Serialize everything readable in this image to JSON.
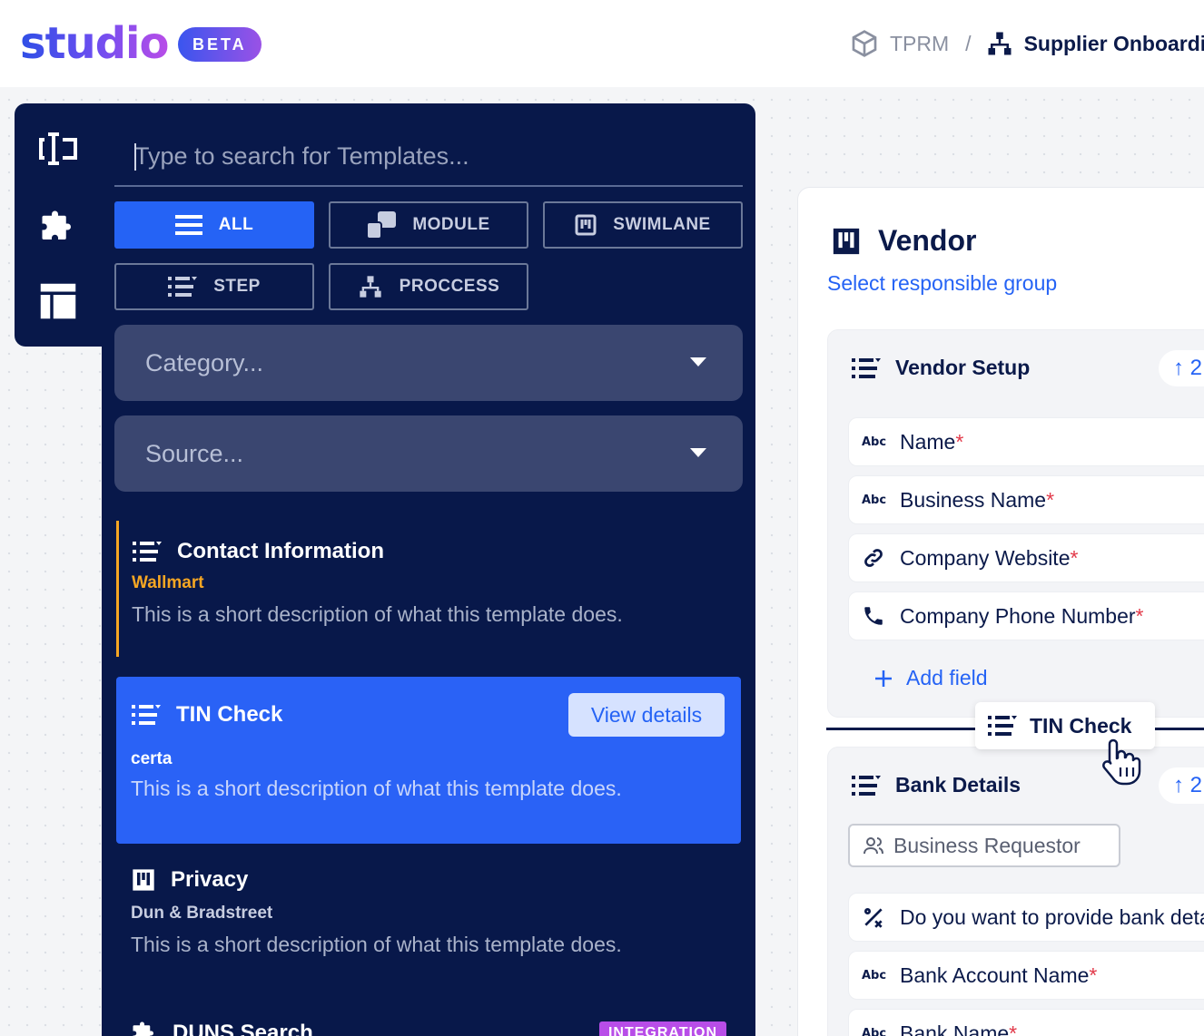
{
  "header": {
    "logo_text": "studio",
    "beta_label": "BETA",
    "breadcrumb": {
      "first": "TPRM",
      "separator": "/",
      "second": "Supplier Onboarding"
    }
  },
  "rail": {
    "icons": [
      "text-cursor-icon",
      "puzzle-icon",
      "layout-icon"
    ]
  },
  "panel": {
    "search_placeholder": "Type to search for Templates...",
    "filters": [
      {
        "label": "ALL",
        "active": true,
        "icon": "menu-icon"
      },
      {
        "label": "MODULE",
        "active": false,
        "icon": "module-icon"
      },
      {
        "label": "SWIMLANE",
        "active": false,
        "icon": "swimlane-icon"
      },
      {
        "label": "STEP",
        "active": false,
        "icon": "step-icon"
      },
      {
        "label": "PROCCESS",
        "active": false,
        "icon": "process-icon"
      }
    ],
    "category_placeholder": "Category...",
    "source_placeholder": "Source...",
    "templates": [
      {
        "title": "Contact Information",
        "source": "Wallmart",
        "source_color": "#f5a623",
        "description": "This is a short description of what this template does."
      },
      {
        "title": "TIN Check",
        "source": "certa",
        "source_color": "#ffffff",
        "description": "This is a short description of what this template does.",
        "action": "View details"
      },
      {
        "title": "Privacy",
        "source": "Dun & Bradstreet",
        "source_color": "#c7cde0",
        "description": "This is a short description of what this template does."
      },
      {
        "title": "DUNS Search",
        "badge": "INTEGRATION"
      }
    ]
  },
  "canvas": {
    "swimlane_title": "Vendor",
    "responsible_group_link": "Select responsible group",
    "steps": [
      {
        "title": "Vendor Setup",
        "order": "↑ 2",
        "fields": [
          {
            "label": "Name",
            "required": "*",
            "icon": "abc"
          },
          {
            "label": "Business Name",
            "required": "*",
            "icon": "abc"
          },
          {
            "label": "Company Website",
            "required": "*",
            "icon": "link"
          },
          {
            "label": "Company Phone Number",
            "required": "*",
            "icon": "phone"
          }
        ],
        "add_field_label": "Add field"
      },
      {
        "title": "Bank Details",
        "order": "↑ 2",
        "requestor": "Business Requestor",
        "fields": [
          {
            "label": "Do you want to provide bank details?",
            "required": "",
            "icon": "percent"
          },
          {
            "label": "Bank Account Name",
            "required": "*",
            "icon": "abc"
          },
          {
            "label": "Bank Name",
            "required": "*",
            "icon": "abc"
          }
        ]
      }
    ],
    "drag_ghost_label": "TIN Check"
  },
  "icon_text": {
    "abc": "Abc"
  },
  "colors": {
    "accent": "#2563f5",
    "navy": "#08184a",
    "required": "#e23a4a",
    "source_orange": "#f5a623",
    "badge_purple": "#b84de8"
  }
}
